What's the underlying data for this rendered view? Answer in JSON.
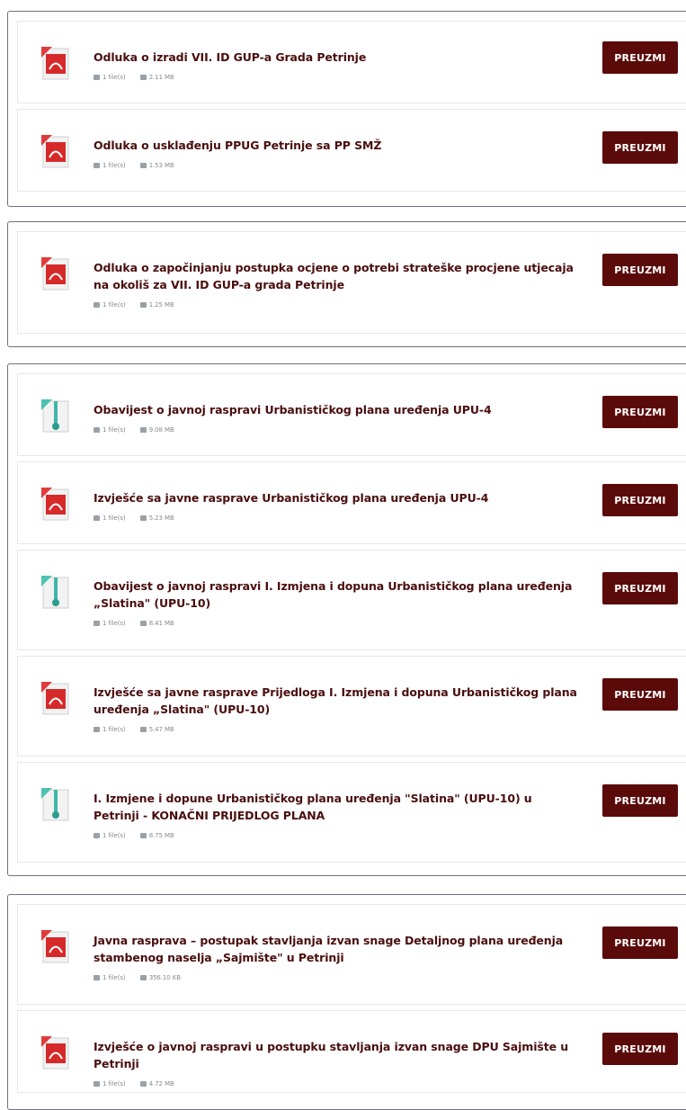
{
  "button_label": "PREUZMI",
  "groups": [
    {
      "items": [
        {
          "title": "Odluka o izradi VII. ID GUP-a Grada Petrinje",
          "files": "1 file(s)",
          "size": "2.11 MB",
          "icon": "pdf-icon"
        },
        {
          "title": "Odluka o usklađenju PPUG Petrinje sa PP SMŽ",
          "files": "1 file(s)",
          "size": "1.53 MB",
          "icon": "pdf-icon"
        }
      ]
    },
    {
      "items": [
        {
          "title": "Odluka o započinjanju postupka ocjene o potrebi strateške procjene utjecaja na okoliš za VII. ID GUP-a grada Petrinje",
          "files": "1 file(s)",
          "size": "1.25 MB",
          "icon": "pdf-icon"
        }
      ]
    },
    {
      "items": [
        {
          "title": "Obavijest o javnoj raspravi Urbanističkog plana uređenja UPU-4",
          "files": "1 file(s)",
          "size": "9.08 MB",
          "icon": "zip-icon"
        },
        {
          "title": "Izvješće sa javne rasprave Urbanističkog plana uređenja UPU-4",
          "files": "1 file(s)",
          "size": "5.23 MB",
          "icon": "pdf-icon"
        },
        {
          "title": "Obavijest o javnoj raspravi I. Izmjena i dopuna Urbanističkog plana uređenja „Slatina\" (UPU-10)",
          "files": "1 file(s)",
          "size": "8.41 MB",
          "icon": "zip-icon"
        },
        {
          "title": "Izvješće sa javne rasprave Prijedloga I. Izmjena i dopuna Urbanističkog plana uređenja „Slatina\" (UPU-10)",
          "files": "1 file(s)",
          "size": "5.47 MB",
          "icon": "pdf-icon"
        },
        {
          "title": "I. Izmjene i dopune Urbanističkog plana uređenja \"Slatina\" (UPU-10) u Petrinji - KONAČNI PRIJEDLOG PLANA",
          "files": "1 file(s)",
          "size": "8.75 MB",
          "icon": "zip-icon"
        }
      ]
    },
    {
      "items": [
        {
          "title": "Javna rasprava – postupak stavljanja izvan snage Detaljnog plana uređenja stambenog naselja „Sajmište\" u Petrinji",
          "files": "1 file(s)",
          "size": "356.10 KB",
          "icon": "pdf-icon"
        },
        {
          "title": "Izvješće o javnoj raspravi u postupku stavljanja izvan snage DPU Sajmište u Petrinji",
          "files": "1 file(s)",
          "size": "4.72 MB",
          "icon": "pdf-icon"
        }
      ]
    }
  ]
}
